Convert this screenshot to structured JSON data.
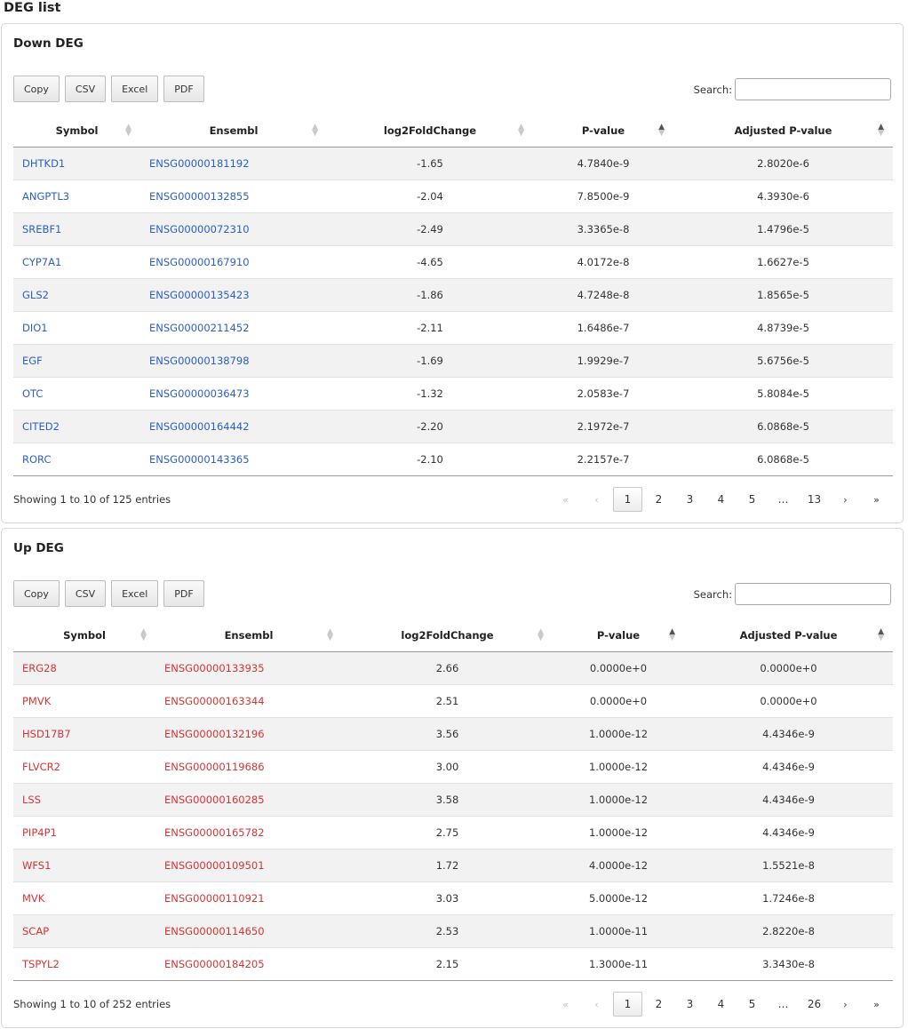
{
  "page_title": "DEG list",
  "search_label": "Search:",
  "buttons": [
    "Copy",
    "CSV",
    "Excel",
    "PDF"
  ],
  "columns": [
    "Symbol",
    "Ensembl",
    "log2FoldChange",
    "P-value",
    "Adjusted P-value"
  ],
  "down": {
    "title": "Down DEG",
    "info": "Showing 1 to 10 of 125 entries",
    "pages": [
      "«",
      "‹",
      "1",
      "2",
      "3",
      "4",
      "5",
      "…",
      "13",
      "›",
      "»"
    ],
    "rows": [
      [
        "DHTKD1",
        "ENSG00000181192",
        "-1.65",
        "4.7840e-9",
        "2.8020e-6"
      ],
      [
        "ANGPTL3",
        "ENSG00000132855",
        "-2.04",
        "7.8500e-9",
        "4.3930e-6"
      ],
      [
        "SREBF1",
        "ENSG00000072310",
        "-2.49",
        "3.3365e-8",
        "1.4796e-5"
      ],
      [
        "CYP7A1",
        "ENSG00000167910",
        "-4.65",
        "4.0172e-8",
        "1.6627e-5"
      ],
      [
        "GLS2",
        "ENSG00000135423",
        "-1.86",
        "4.7248e-8",
        "1.8565e-5"
      ],
      [
        "DIO1",
        "ENSG00000211452",
        "-2.11",
        "1.6486e-7",
        "4.8739e-5"
      ],
      [
        "EGF",
        "ENSG00000138798",
        "-1.69",
        "1.9929e-7",
        "5.6756e-5"
      ],
      [
        "OTC",
        "ENSG00000036473",
        "-1.32",
        "2.0583e-7",
        "5.8084e-5"
      ],
      [
        "CITED2",
        "ENSG00000164442",
        "-2.20",
        "2.1972e-7",
        "6.0868e-5"
      ],
      [
        "RORC",
        "ENSG00000143365",
        "-2.10",
        "2.2157e-7",
        "6.0868e-5"
      ]
    ]
  },
  "up": {
    "title": "Up DEG",
    "info": "Showing 1 to 10 of 252 entries",
    "pages": [
      "«",
      "‹",
      "1",
      "2",
      "3",
      "4",
      "5",
      "…",
      "26",
      "›",
      "»"
    ],
    "rows": [
      [
        "ERG28",
        "ENSG00000133935",
        "2.66",
        "0.0000e+0",
        "0.0000e+0"
      ],
      [
        "PMVK",
        "ENSG00000163344",
        "2.51",
        "0.0000e+0",
        "0.0000e+0"
      ],
      [
        "HSD17B7",
        "ENSG00000132196",
        "3.56",
        "1.0000e-12",
        "4.4346e-9"
      ],
      [
        "FLVCR2",
        "ENSG00000119686",
        "3.00",
        "1.0000e-12",
        "4.4346e-9"
      ],
      [
        "LSS",
        "ENSG00000160285",
        "3.58",
        "1.0000e-12",
        "4.4346e-9"
      ],
      [
        "PIP4P1",
        "ENSG00000165782",
        "2.75",
        "1.0000e-12",
        "4.4346e-9"
      ],
      [
        "WFS1",
        "ENSG00000109501",
        "1.72",
        "4.0000e-12",
        "1.5521e-8"
      ],
      [
        "MVK",
        "ENSG00000110921",
        "3.03",
        "5.0000e-12",
        "1.7246e-8"
      ],
      [
        "SCAP",
        "ENSG00000114650",
        "2.53",
        "1.0000e-11",
        "2.8220e-8"
      ],
      [
        "TSPYL2",
        "ENSG00000184205",
        "2.15",
        "1.3000e-11",
        "3.3430e-8"
      ]
    ]
  },
  "colors": {
    "down_link": "#2b5fc4",
    "up_link": "#d63434"
  }
}
